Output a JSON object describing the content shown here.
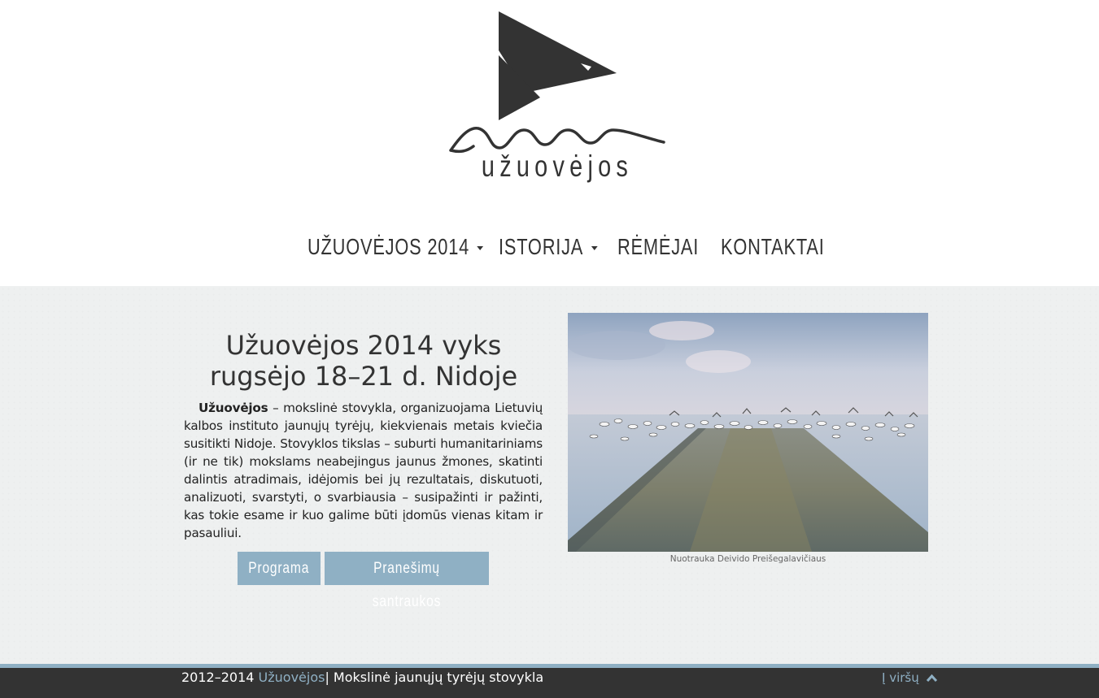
{
  "brand": {
    "wordmark": "užuovėjos"
  },
  "nav": {
    "items": [
      {
        "label": "UŽUOVĖJOS 2014",
        "has_dropdown": true
      },
      {
        "label": "ISTORIJA",
        "has_dropdown": true
      },
      {
        "label": "RĖMĖJAI",
        "has_dropdown": false
      },
      {
        "label": "KONTAKTAI",
        "has_dropdown": false
      }
    ]
  },
  "main": {
    "headline_line1": "Užuovėjos 2014 vyks",
    "headline_line2": "rugsėjo 18–21 d. Nidoje",
    "intro_bold": "Užuovėjos",
    "intro_text": " – mokslinė stovykla, organizuojama Lietuvių kalbos instituto jaunųjų tyrėjų, kiekvienais metais kviečia susitikti Nidoje. Stovyklos tikslas – suburti humanitariniams (ir ne tik) mokslams neabejingus jaunus žmones, skatinti dalintis atradimais, idėjomis bei jų rezultatais, diskutuoti, analizuoti, svarstyti, o svarbiausia – susipažinti ir pažinti, kas tokie esame ir kuo galime būti įdomūs vienas kitam ir pasauliui.",
    "buttons": {
      "program": "Programa",
      "abstracts": "Pranešimų santraukos"
    },
    "photo_caption": "Nuotrauka Deivido Preišegalavičiaus"
  },
  "footer": {
    "years": "2012–2014",
    "brand_link": "Užuovėjos",
    "separator": "|",
    "tagline": " Mokslinė jaunųjų tyrėjų stovykla",
    "to_top": "Į viršų"
  },
  "colors": {
    "accent": "#8fb0c4",
    "dark": "#333333",
    "background": "#eef0f0"
  },
  "icons": [
    "logo-bird-icon",
    "logo-wave-icon",
    "caret-down-icon",
    "chevron-up-icon"
  ]
}
